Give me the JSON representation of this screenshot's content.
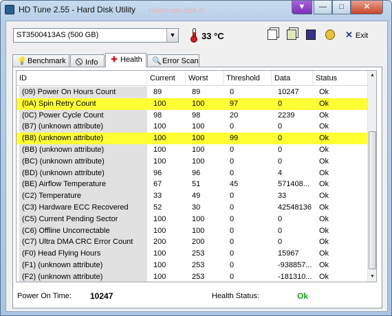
{
  "window": {
    "title": "HD Tune 2.55 - Hard Disk Utility",
    "title_ghost": "Hibernate disk 0"
  },
  "toolbar": {
    "drive": "ST3500413AS (500 GB)",
    "temperature": "33 °C",
    "exit_label": "Exit"
  },
  "tabs": [
    {
      "label": "Benchmark",
      "icon": "gauge-icon"
    },
    {
      "label": "Info",
      "icon": "info-icon"
    },
    {
      "label": "Health",
      "icon": "health-cross-icon",
      "active": true
    },
    {
      "label": "Error Scan",
      "icon": "magnifier-icon"
    }
  ],
  "table": {
    "columns": [
      "ID",
      "Current",
      "Worst",
      "Threshold",
      "Data",
      "Status"
    ],
    "rows": [
      {
        "id": "(09) Power On Hours Count",
        "current": "89",
        "worst": "89",
        "threshold": "0",
        "data": "10247",
        "status": "Ok",
        "highlight": false
      },
      {
        "id": "(0A) Spin Retry Count",
        "current": "100",
        "worst": "100",
        "threshold": "97",
        "data": "0",
        "status": "Ok",
        "highlight": true
      },
      {
        "id": "(0C) Power Cycle Count",
        "current": "98",
        "worst": "98",
        "threshold": "20",
        "data": "2239",
        "status": "Ok",
        "highlight": false
      },
      {
        "id": "(B7) (unknown attribute)",
        "current": "100",
        "worst": "100",
        "threshold": "0",
        "data": "0",
        "status": "Ok",
        "highlight": false
      },
      {
        "id": "(B8) (unknown attribute)",
        "current": "100",
        "worst": "100",
        "threshold": "99",
        "data": "0",
        "status": "Ok",
        "highlight": true
      },
      {
        "id": "(BB) (unknown attribute)",
        "current": "100",
        "worst": "100",
        "threshold": "0",
        "data": "0",
        "status": "Ok",
        "highlight": false
      },
      {
        "id": "(BC) (unknown attribute)",
        "current": "100",
        "worst": "100",
        "threshold": "0",
        "data": "0",
        "status": "Ok",
        "highlight": false
      },
      {
        "id": "(BD) (unknown attribute)",
        "current": "96",
        "worst": "96",
        "threshold": "0",
        "data": "4",
        "status": "Ok",
        "highlight": false
      },
      {
        "id": "(BE) Airflow Temperature",
        "current": "67",
        "worst": "51",
        "threshold": "45",
        "data": "571408...",
        "status": "Ok",
        "highlight": false
      },
      {
        "id": "(C2) Temperature",
        "current": "33",
        "worst": "49",
        "threshold": "0",
        "data": "33",
        "status": "Ok",
        "highlight": false
      },
      {
        "id": "(C3) Hardware ECC Recovered",
        "current": "52",
        "worst": "30",
        "threshold": "0",
        "data": "42548136",
        "status": "Ok",
        "highlight": false
      },
      {
        "id": "(C5) Current Pending Sector",
        "current": "100",
        "worst": "100",
        "threshold": "0",
        "data": "0",
        "status": "Ok",
        "highlight": false
      },
      {
        "id": "(C6) Offline Uncorrectable",
        "current": "100",
        "worst": "100",
        "threshold": "0",
        "data": "0",
        "status": "Ok",
        "highlight": false
      },
      {
        "id": "(C7) Ultra DMA CRC Error Count",
        "current": "200",
        "worst": "200",
        "threshold": "0",
        "data": "0",
        "status": "Ok",
        "highlight": false
      },
      {
        "id": "(F0) Head Flying Hours",
        "current": "100",
        "worst": "253",
        "threshold": "0",
        "data": "15967",
        "status": "Ok",
        "highlight": false
      },
      {
        "id": "(F1) (unknown attribute)",
        "current": "100",
        "worst": "253",
        "threshold": "0",
        "data": "-938857...",
        "status": "Ok",
        "highlight": false
      },
      {
        "id": "(F2) (unknown attribute)",
        "current": "100",
        "worst": "253",
        "threshold": "0",
        "data": "-181310...",
        "status": "Ok",
        "highlight": false
      }
    ]
  },
  "footer": {
    "power_on_label": "Power On Time:",
    "power_on_value": "10247",
    "health_label": "Health Status:",
    "health_value": "Ok"
  },
  "colors": {
    "highlight": "#ffff33",
    "health_ok": "#1aa01a",
    "temperature_icon": "#d21c1c"
  }
}
